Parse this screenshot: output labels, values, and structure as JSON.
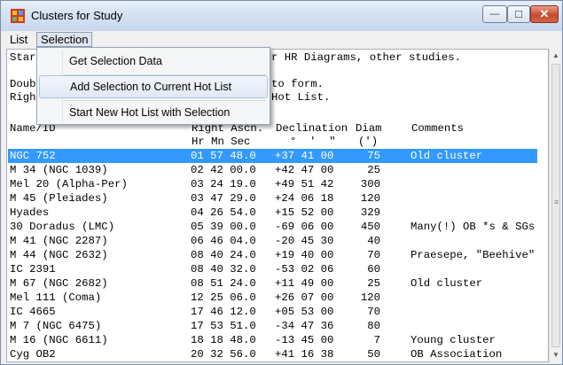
{
  "window": {
    "title": "Clusters for Study",
    "min_glyph": "—",
    "max_glyph": "☐",
    "close_glyph": "✕"
  },
  "menubar": {
    "list_label": "List",
    "selection_label": "Selection"
  },
  "dropdown": {
    "items": [
      "Get Selection Data",
      "Add Selection to Current Hot List",
      "Start New Hot List with Selection"
    ]
  },
  "intro": {
    "line1_left": "Star",
    "line1_right": "r HR Diagrams, other studies.",
    "line2_left": "Doub",
    "line2_right": "to form.",
    "line3_left": "Righ",
    "line3_right": "Hot List."
  },
  "headers": {
    "name": "Name/ID",
    "ra": "Right Ascn.",
    "dec": "Declination",
    "diam": "Diam",
    "comments": "Comments",
    "ra_units": "Hr Mn Sec",
    "dec_units": "°  '  \"",
    "diam_units": "(')"
  },
  "rows": [
    {
      "name": "NGC 752",
      "ra": "01 57 48.0",
      "dec": "+37 41 00",
      "diam": "75",
      "comment": "Old cluster",
      "selected": true
    },
    {
      "name": "M 34 (NGC 1039)",
      "ra": "02 42 00.0",
      "dec": "+42 47 00",
      "diam": "25",
      "comment": ""
    },
    {
      "name": "Mel 20 (Alpha-Per)",
      "ra": "03 24 19.0",
      "dec": "+49 51 42",
      "diam": "300",
      "comment": ""
    },
    {
      "name": "M 45 (Pleiades)",
      "ra": "03 47 29.0",
      "dec": "+24 06 18",
      "diam": "120",
      "comment": ""
    },
    {
      "name": "Hyades",
      "ra": "04 26 54.0",
      "dec": "+15 52 00",
      "diam": "329",
      "comment": ""
    },
    {
      "name": "30 Doradus (LMC)",
      "ra": "05 39 00.0",
      "dec": "-69 06 00",
      "diam": "450",
      "comment": "Many(!) OB *s & SGs"
    },
    {
      "name": "M 41 (NGC 2287)",
      "ra": "06 46 04.0",
      "dec": "-20 45 30",
      "diam": "40",
      "comment": ""
    },
    {
      "name": "M 44 (NGC 2632)",
      "ra": "08 40 24.0",
      "dec": "+19 40 00",
      "diam": "70",
      "comment": "Praesepe, \"Beehive\""
    },
    {
      "name": "IC 2391",
      "ra": "08 40 32.0",
      "dec": "-53 02 06",
      "diam": "60",
      "comment": ""
    },
    {
      "name": "M 67 (NGC 2682)",
      "ra": "08 51 24.0",
      "dec": "+11 49 00",
      "diam": "25",
      "comment": "Old cluster"
    },
    {
      "name": "Mel 111 (Coma)",
      "ra": "12 25 06.0",
      "dec": "+26 07 00",
      "diam": "120",
      "comment": ""
    },
    {
      "name": "IC 4665",
      "ra": "17 46 12.0",
      "dec": "+05 53 00",
      "diam": "70",
      "comment": ""
    },
    {
      "name": "M 7 (NGC 6475)",
      "ra": "17 53 51.0",
      "dec": "-34 47 36",
      "diam": "80",
      "comment": ""
    },
    {
      "name": "M 16 (NGC 6611)",
      "ra": "18 18 48.0",
      "dec": "-13 45 00",
      "diam": "7",
      "comment": "Young cluster"
    },
    {
      "name": "Cyg OB2",
      "ra": "20 32 56.0",
      "dec": "+41 16 38",
      "diam": "50",
      "comment": "OB Association"
    }
  ],
  "scrollbar": {
    "up_glyph": "▲",
    "down_glyph": "▼",
    "grip_glyph": "≡"
  }
}
